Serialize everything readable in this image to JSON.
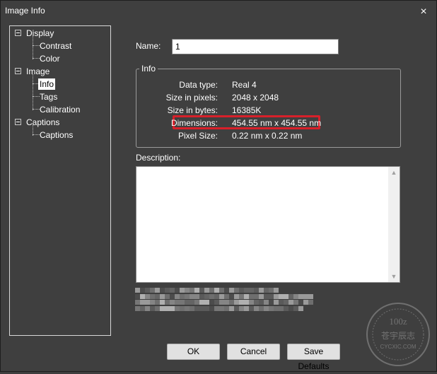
{
  "window": {
    "title": "Image Info",
    "close_glyph": "×"
  },
  "tree": [
    {
      "label": "Display",
      "children": [
        "Contrast",
        "Color"
      ]
    },
    {
      "label": "Image",
      "children": [
        "Info",
        "Tags",
        "Calibration"
      ],
      "selected_child": "Info"
    },
    {
      "label": "Captions",
      "children": [
        "Captions"
      ]
    }
  ],
  "name": {
    "label": "Name:",
    "value": "1"
  },
  "info": {
    "legend": "Info",
    "rows": [
      {
        "label": "Data type:",
        "value": "Real 4"
      },
      {
        "label": "Size in pixels:",
        "value": "2048 x 2048"
      },
      {
        "label": "Size in bytes:",
        "value": "16385K"
      },
      {
        "label": "Dimensions:",
        "value": "454.55 nm x 454.55 nm",
        "highlighted": true
      },
      {
        "label": "Pixel Size:",
        "value": "0.22 nm x 0.22 nm"
      }
    ]
  },
  "description": {
    "label": "Description:",
    "value": ""
  },
  "buttons": {
    "ok": "OK",
    "cancel": "Cancel",
    "save_defaults": "Save Defaults"
  },
  "watermark": {
    "top_text": "100z",
    "middle_text": "苍宇辰志",
    "bottom_text": "CYCXIC.COM"
  },
  "colors": {
    "background": "#3f3f3f",
    "highlight_border": "#d8202a",
    "selected_bg": "#ffffff"
  }
}
